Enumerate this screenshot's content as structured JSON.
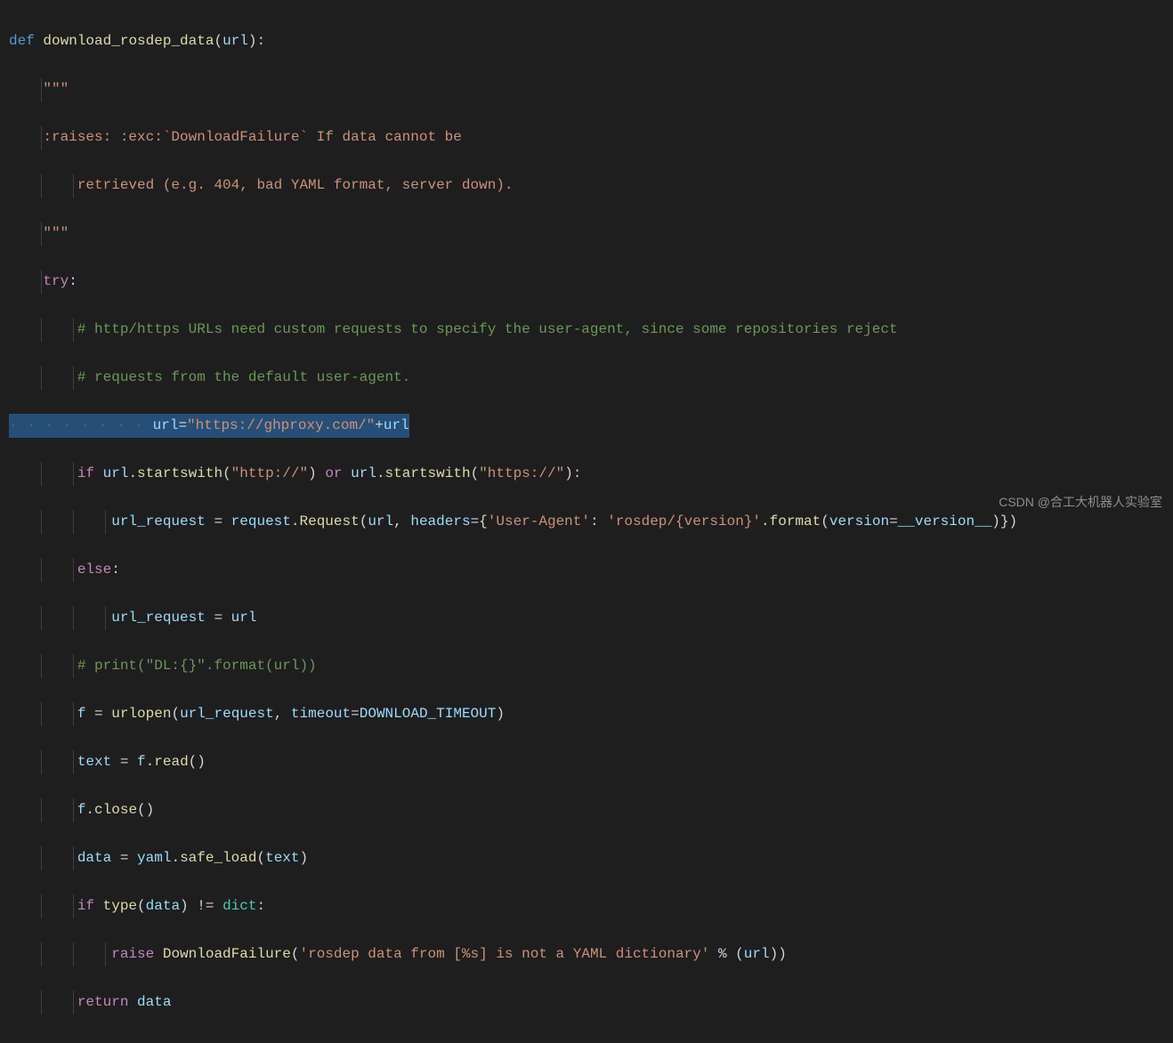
{
  "code": {
    "def": "def",
    "func_name": "download_rosdep_data",
    "param": "url",
    "docstring_open": "\"\"\"",
    "docstring_line1": ":raises: :exc:`DownloadFailure` If data cannot be",
    "docstring_line2": "    retrieved (e.g. 404, bad YAML format, server down).",
    "docstring_close": "\"\"\"",
    "try": "try",
    "comment1": "# http/https URLs need custom requests to specify the user-agent, since some repositories reject",
    "comment2": "# requests from the default user-agent.",
    "url_assign_var": "url",
    "url_assign_eq": "=",
    "url_assign_str": "\"https://ghproxy.com/\"",
    "url_assign_plus": "+",
    "url_assign_rhs": "url",
    "if": "if",
    "url_var": "url",
    "startswith": "startswith",
    "http_str": "\"http://\"",
    "or": "or",
    "https_str": "\"https://\"",
    "url_request": "url_request",
    "request_mod": "request",
    "request_cls": "Request",
    "headers_kw": "headers",
    "user_agent_key": "'User-Agent'",
    "user_agent_val": "'rosdep/{version}'",
    "format": "format",
    "version_kw": "version",
    "version_var": "__version__",
    "else": "else",
    "comment3": "# print(\"DL:{}\".format(url))",
    "f_var": "f",
    "urlopen": "urlopen",
    "timeout_kw": "timeout",
    "download_timeout": "DOWNLOAD_TIMEOUT",
    "text_var": "text",
    "read": "read",
    "close": "close",
    "data_var": "data",
    "yaml_var": "yaml",
    "safe_load": "safe_load",
    "type_fn": "type",
    "dict_type": "dict",
    "raise": "raise",
    "download_failure": "DownloadFailure",
    "error_str": "'rosdep data from [%s] is not a YAML dictionary'",
    "return": "return"
  },
  "watermark": "CSDN @合工大机器人实验室"
}
